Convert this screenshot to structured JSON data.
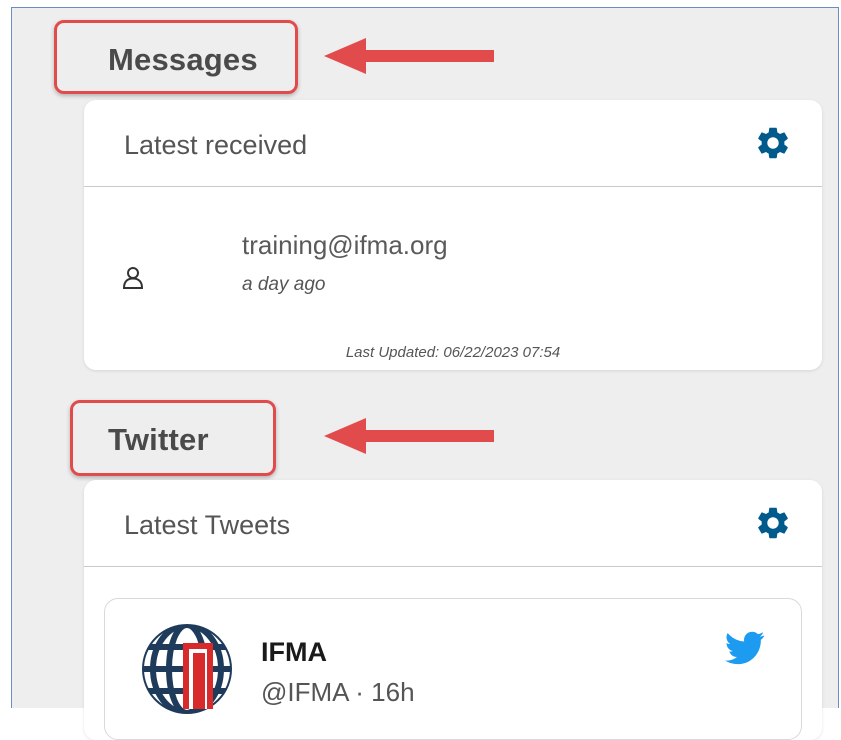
{
  "messages": {
    "section_title": "Messages",
    "header": "Latest received",
    "from": "training@ifma.org",
    "received_ago": "a day ago",
    "last_updated": "Last Updated: 06/22/2023 07:54"
  },
  "twitter": {
    "section_title": "Twitter",
    "header": "Latest Tweets",
    "tweet": {
      "account_name": "IFMA",
      "handle_time": "@IFMA · 16h"
    }
  },
  "icons": {
    "settings": "gear-icon",
    "user": "user-icon",
    "twitter": "twitter-bird-icon",
    "annotation": "red-arrow"
  },
  "colors": {
    "accent": "#005a8c",
    "annotation": "#e24b4b",
    "twitter": "#1d9bf0",
    "panel_bg": "#eeeeee"
  }
}
